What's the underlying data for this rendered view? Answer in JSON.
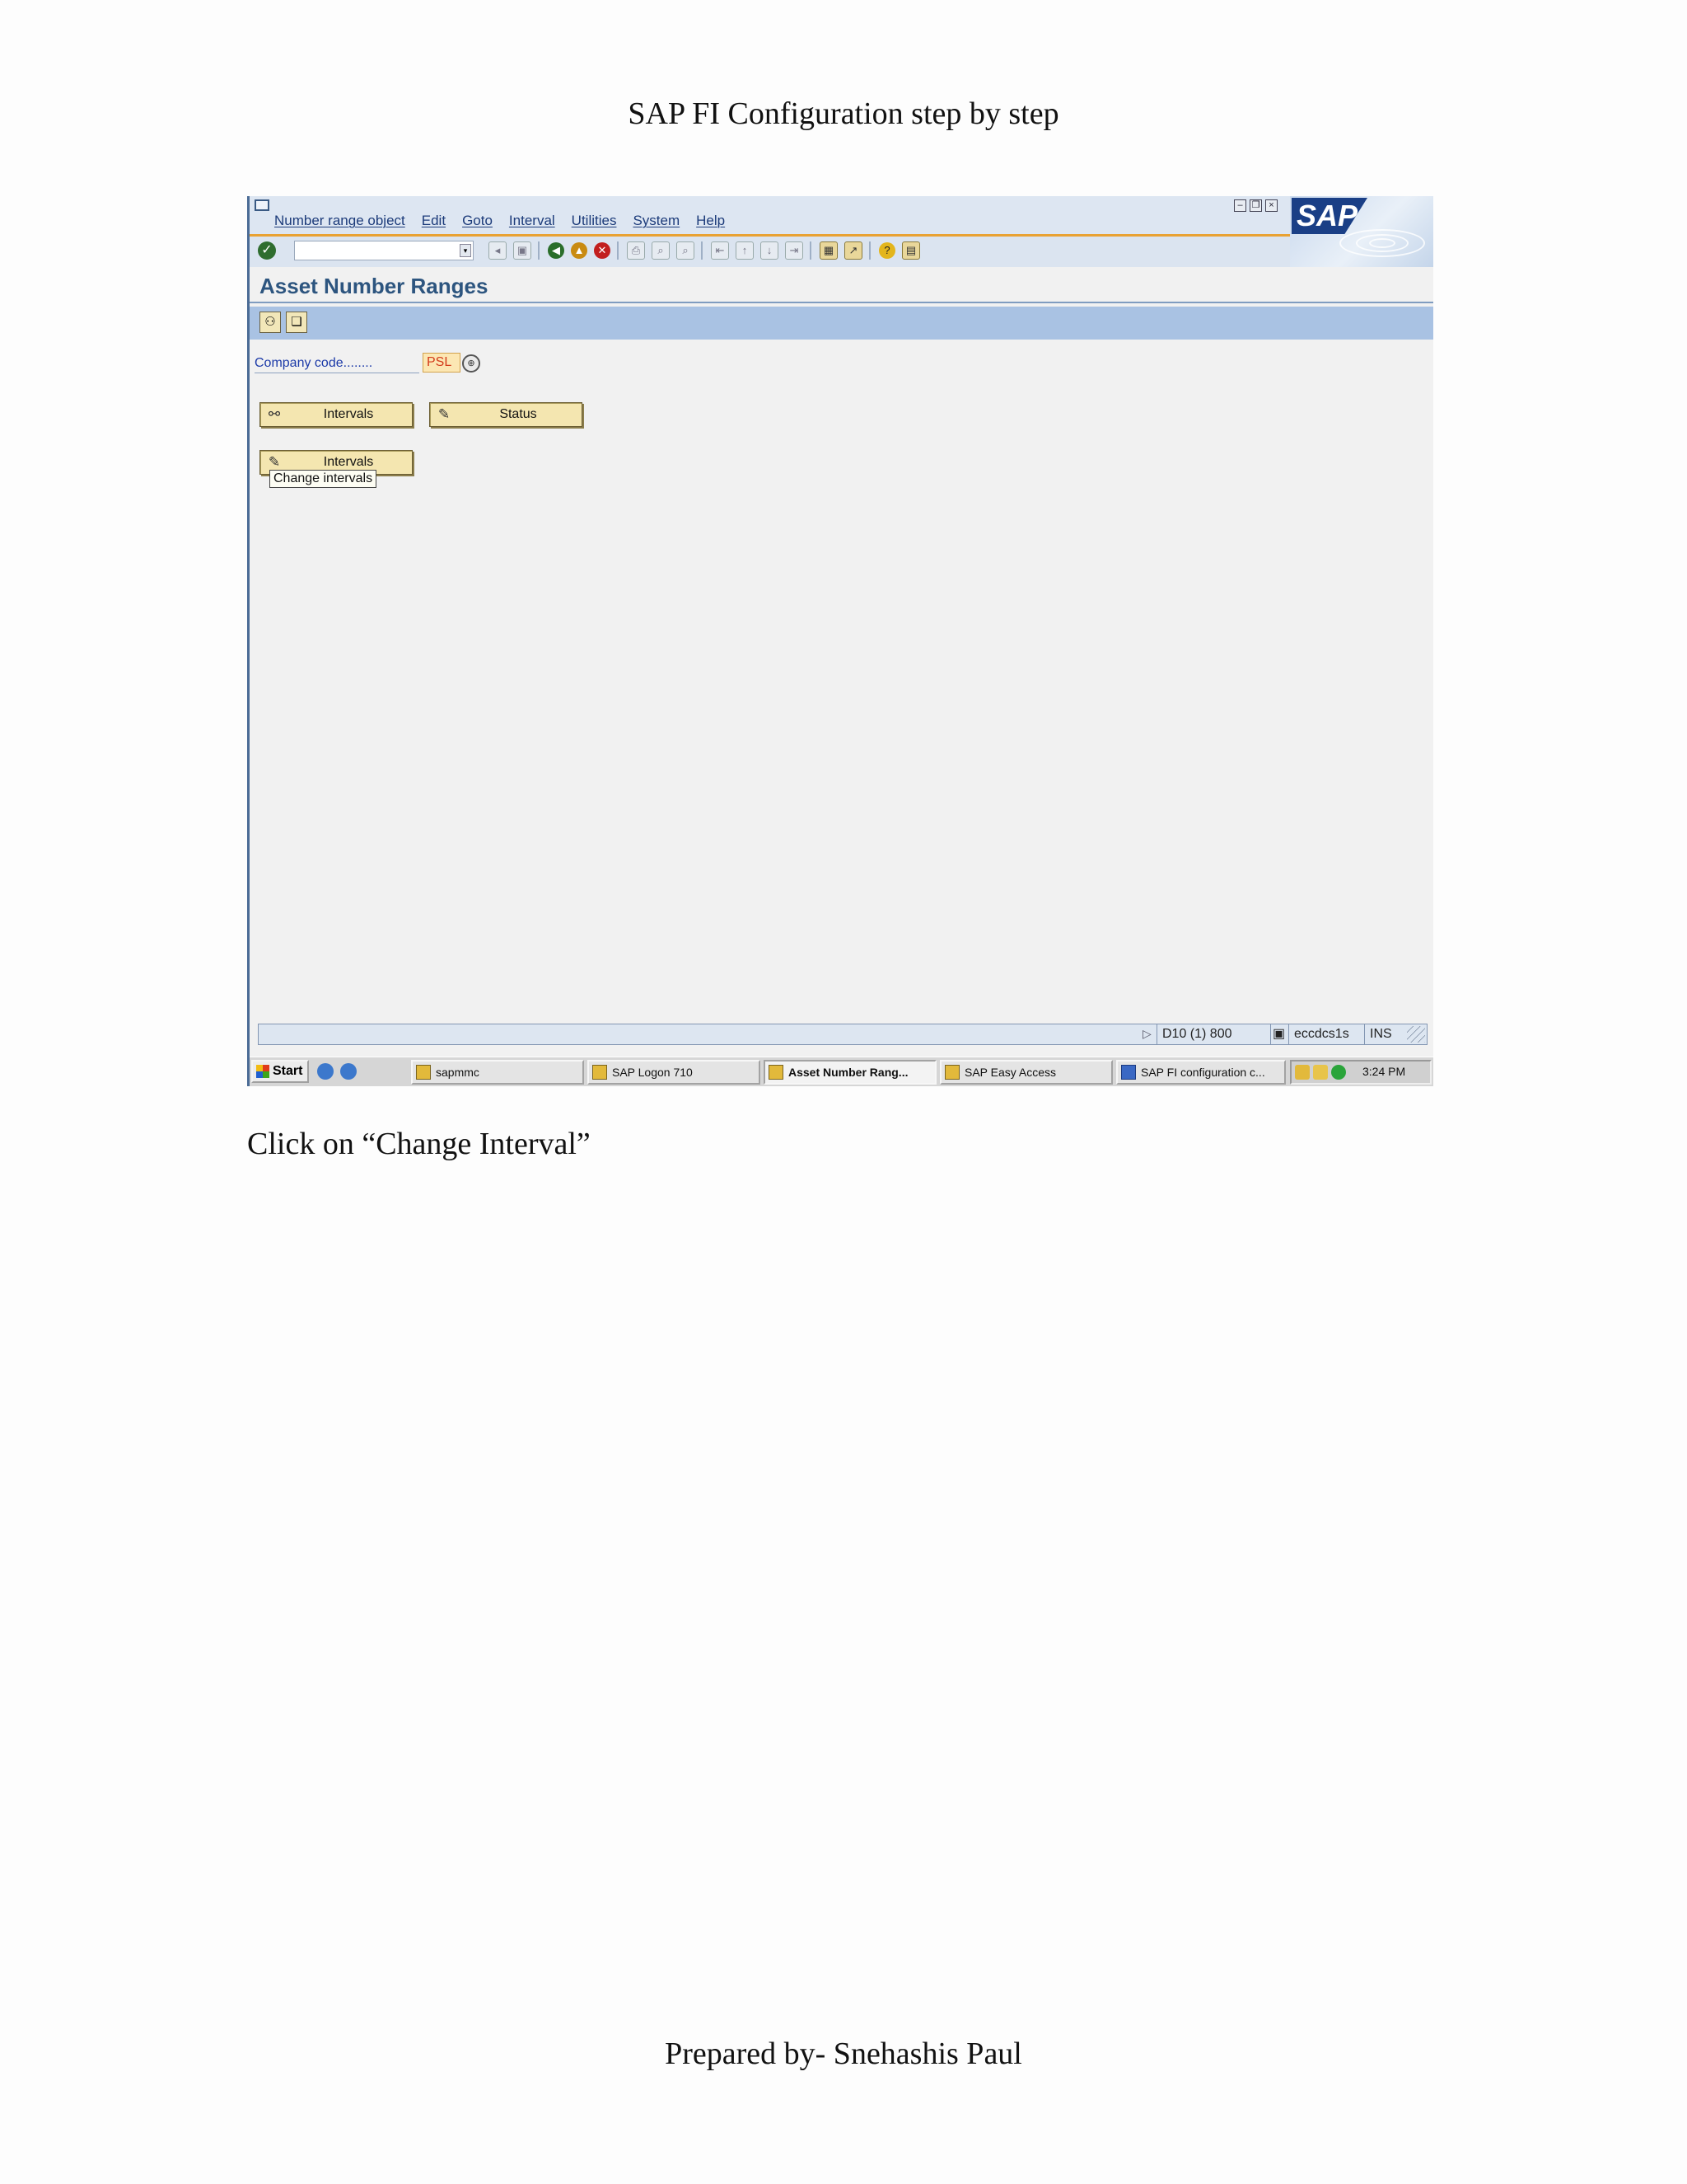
{
  "doc": {
    "title": "SAP FI Configuration step by step",
    "caption": "Click on “Change Interval”",
    "footer": "Prepared by- Snehashis Paul"
  },
  "sap": {
    "menu": [
      "Number range object",
      "Edit",
      "Goto",
      "Interval",
      "Utilities",
      "System",
      "Help"
    ],
    "logo_text": "SAP",
    "screen_title": "Asset Number Ranges",
    "company_code_label": "Company code........",
    "company_code_value": "PSL",
    "buttons": {
      "intervals_display": "Intervals",
      "status": "Status",
      "intervals_change": "Intervals"
    },
    "tooltip": "Change intervals",
    "status": {
      "system": "D10 (1) 800",
      "server": "eccdcs1s",
      "mode": "INS"
    },
    "taskbar": {
      "start": "Start",
      "tasks": [
        "sapmmc",
        "SAP Logon 710",
        "Asset Number Rang...",
        "SAP Easy Access",
        "SAP FI configuration c..."
      ],
      "active_task": "Asset Number Rang...",
      "clock": "3:24 PM"
    }
  },
  "colors": {
    "title_blue": "#2d557f",
    "app_toolbar": "#a9c2e3",
    "button_fill": "#f4e6b0",
    "company_code_text": "#d33c1c"
  }
}
